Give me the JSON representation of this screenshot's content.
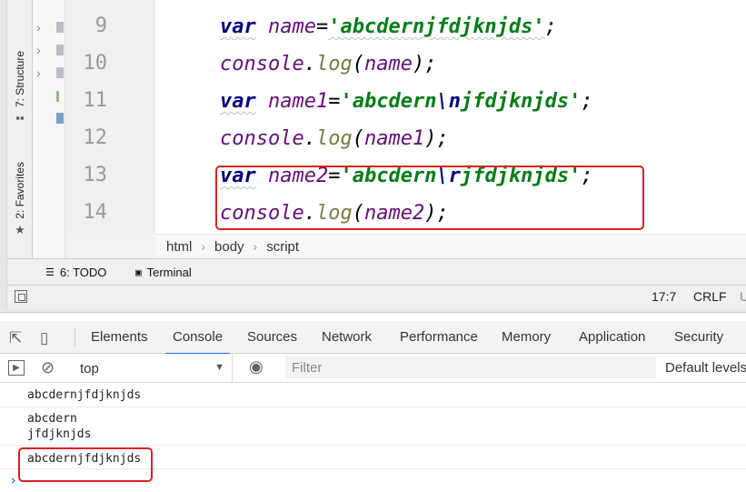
{
  "ide": {
    "sidebar_tabs": [
      {
        "label": "7: Structure",
        "icon": "structure-icon"
      },
      {
        "label": "2: Favorites",
        "icon": "star-icon"
      }
    ],
    "line_numbers": [
      "9",
      "10",
      "11",
      "12",
      "13",
      "14"
    ],
    "code": {
      "l9": {
        "kw": "var",
        "name": "name",
        "eq": "=",
        "str": "'abcdernjfdjknjds'",
        "end": ";"
      },
      "l10": {
        "obj": "console",
        "dot": ".",
        "fn": "log",
        "open": "(",
        "arg": "name",
        "close": ");"
      },
      "l11": {
        "kw": "var",
        "name": "name1",
        "eq": "=",
        "str_a": "'abcdern",
        "esc": "\\n",
        "str_b": "jfdjknjds'",
        "end": ";"
      },
      "l12": {
        "obj": "console",
        "dot": ".",
        "fn": "log",
        "open": "(",
        "arg": "name1",
        "close": ");"
      },
      "l13": {
        "kw": "var",
        "name": "name2",
        "eq": "=",
        "str_a": "'abcdern",
        "esc": "\\r",
        "str_b": "jfdjknjds'",
        "end": ";"
      },
      "l14": {
        "obj": "console",
        "dot": ".",
        "fn": "log",
        "open": "(",
        "arg": "name2",
        "close": ");"
      }
    },
    "breadcrumb": [
      "html",
      "body",
      "script"
    ],
    "tool_windows": [
      {
        "label": "6: TODO",
        "icon": "todo-icon"
      },
      {
        "label": "Terminal",
        "icon": "terminal-icon"
      }
    ],
    "status": {
      "position": "17:7",
      "line_sep": "CRLF",
      "extra": "U"
    }
  },
  "devtools": {
    "tabs": [
      "Elements",
      "Console",
      "Sources",
      "Network",
      "Performance",
      "Memory",
      "Application",
      "Security"
    ],
    "active_tab": "Console",
    "context": "top",
    "filter_placeholder": "Filter",
    "levels_label": "Default levels",
    "messages": [
      [
        "abcdernjfdjknjds"
      ],
      [
        "abcdern",
        "jfdjknjds"
      ],
      [
        "abcdernjfdjknjds"
      ]
    ],
    "prompt_symbol": "›"
  },
  "colors": {
    "highlight": "#e02020",
    "accent": "#1a73e8"
  }
}
